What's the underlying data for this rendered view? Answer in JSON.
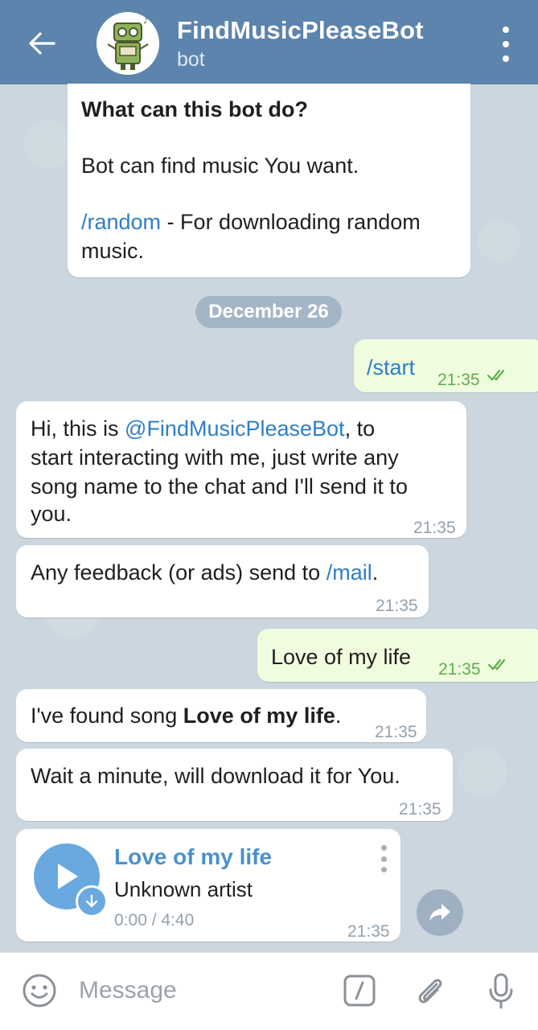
{
  "header": {
    "title": "FindMusicPleaseBot",
    "subtitle": "bot"
  },
  "intro": {
    "heading": "What can this bot do?",
    "line1": "Bot can find music You want.",
    "cmd": "/random",
    "cmd_rest": " - For downloading random",
    "line3": "music."
  },
  "date_separator": "December 26",
  "messages": {
    "m1": {
      "text": "/start",
      "time": "21:35"
    },
    "m2": {
      "pre": "Hi, this is ",
      "mention": "@FindMusicPleaseBot",
      "line1_rest": ", to",
      "line2": "start interacting with me, just write any",
      "line3": "song name to the chat and I'll send it to",
      "line4": "you.",
      "time": "21:35"
    },
    "m3": {
      "pre": "Any feedback (or ads) send to ",
      "cmd": "/mail",
      "post": ".",
      "time": "21:35"
    },
    "m4": {
      "text": "Love of my life",
      "time": "21:35"
    },
    "m5": {
      "pre": "I've found song ",
      "bold": "Love of my life",
      "post": ".",
      "time": "21:35"
    },
    "m6": {
      "text": "Wait a minute, will download it for You.",
      "time": "21:35"
    },
    "audio": {
      "title": "Love of my life",
      "artist": "Unknown artist",
      "progress": "0:00 / 4:40",
      "time": "21:35"
    }
  },
  "input": {
    "placeholder": "Message"
  },
  "colors": {
    "header": "#5d84ac",
    "outgoing_bubble": "#effdde",
    "link": "#2f7ec4",
    "audio_accent": "#6aa9df"
  },
  "icons": [
    "back-arrow-icon",
    "menu-dots-icon",
    "play-icon",
    "download-icon",
    "share-icon",
    "emoji-icon",
    "bot-command-icon",
    "attach-icon",
    "mic-icon",
    "double-check-icon"
  ]
}
